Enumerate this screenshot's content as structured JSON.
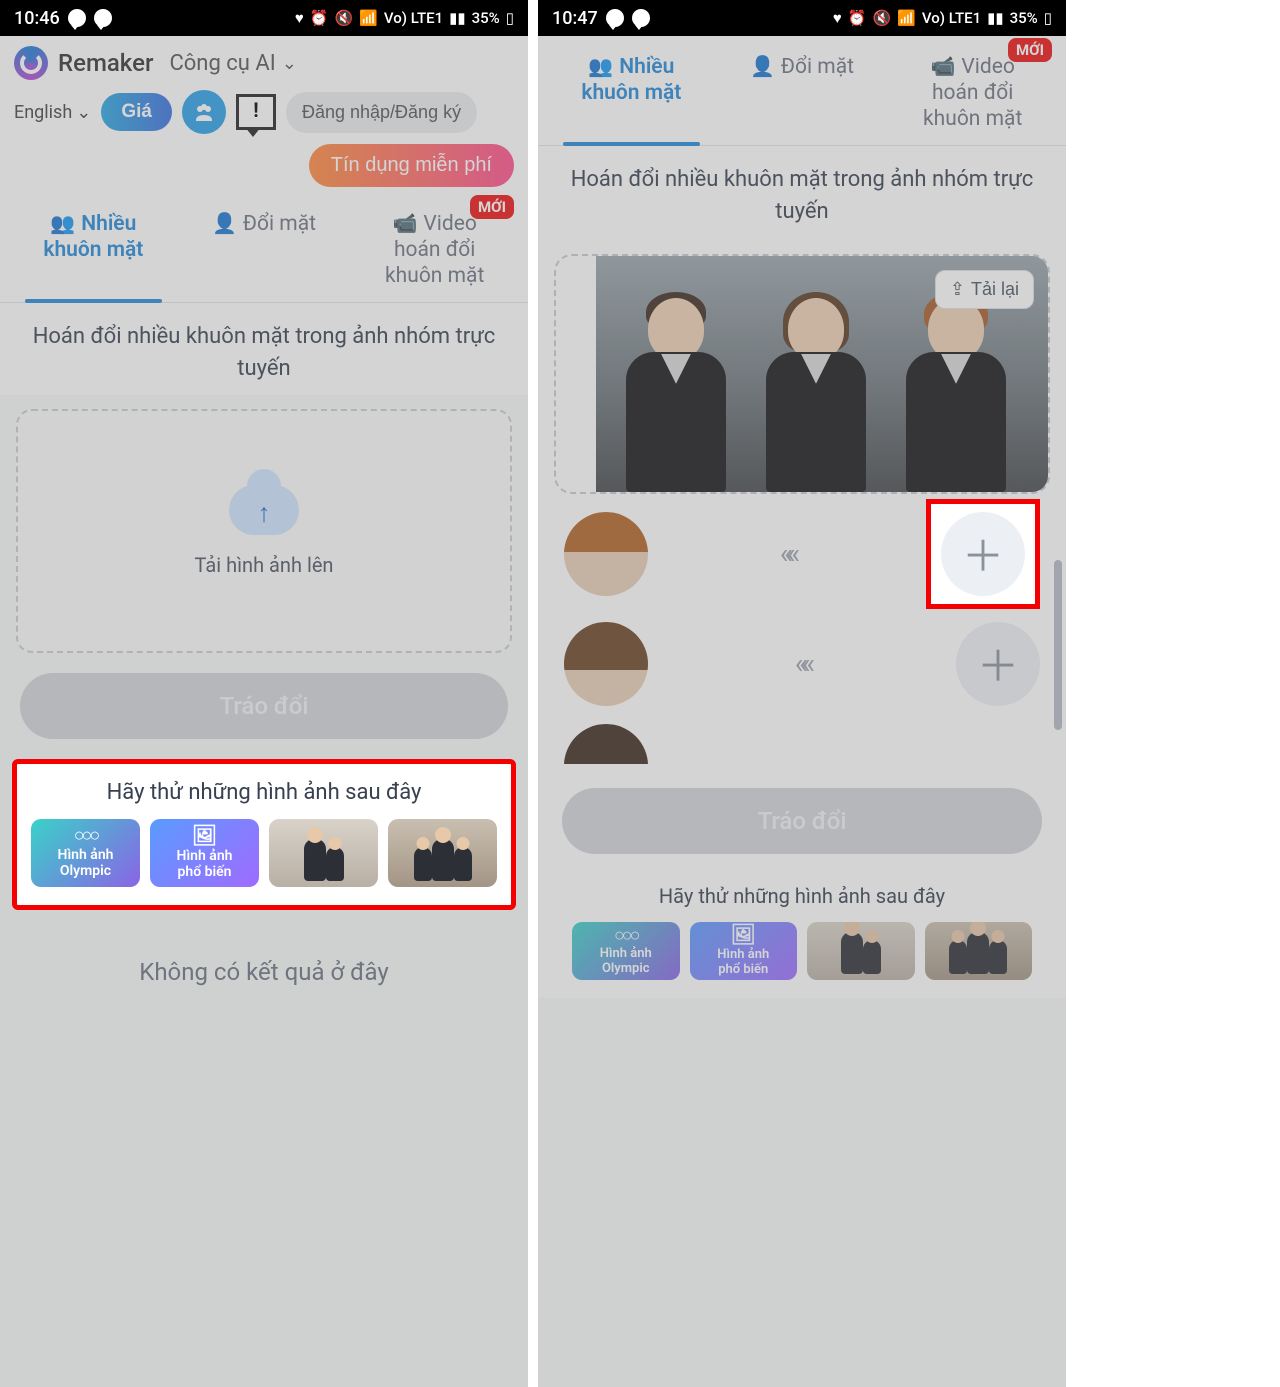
{
  "status": {
    "time_left": "10:46",
    "time_right": "10:47",
    "battery": "35%",
    "network_label": "Vo) LTE1"
  },
  "header": {
    "brand": "Remaker",
    "ai_tools": "Công cụ AI",
    "language": "English",
    "price": "Giá",
    "login": "Đăng nhập/Đăng ký",
    "free_credit": "Tín dụng miễn phí"
  },
  "tabs": {
    "multi_face_line1": "Nhiều",
    "multi_face_line2": "khuôn mặt",
    "swap_face": "Đổi mặt",
    "video_line1": "Video",
    "video_line2": "hoán đổi",
    "video_line3": "khuôn mặt",
    "new_badge": "MỚI"
  },
  "subtitle": "Hoán đổi nhiều khuôn mặt trong ảnh nhóm trực tuyến",
  "upload": {
    "label": "Tải hình ảnh lên"
  },
  "swap_button": "Tráo đổi",
  "try": {
    "title": "Hãy thử những hình ảnh sau đây",
    "olympic_line1": "Hình ảnh",
    "olympic_line2": "Olympic",
    "popular_line1": "Hình ảnh",
    "popular_line2": "phổ biến"
  },
  "no_results": "Không có kết quả ở đây",
  "right": {
    "reupload": "Tải lại"
  }
}
